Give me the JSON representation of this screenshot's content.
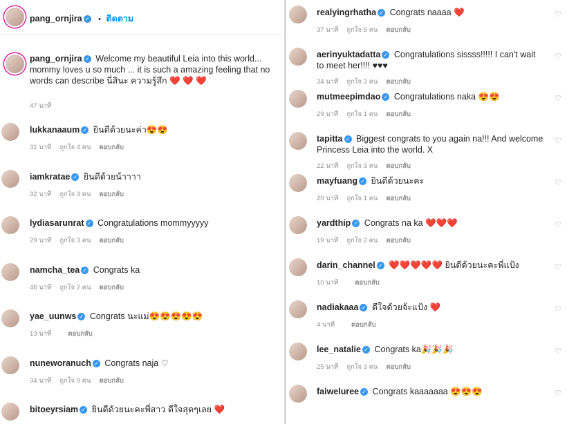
{
  "header": {
    "username": "pang_ornjira",
    "separator": "•",
    "follow_label": "ติดตาม"
  },
  "caption": {
    "username": "pang_ornjira",
    "text": "Welcome my beautiful Leia into this world... mommy loves u so much ... it is such a amazing feeling that no words can describe นี่สินะ ความรู้สึก ❤️ ❤️ ❤️",
    "time": "47 นาที"
  },
  "left_comments": [
    {
      "username": "lukkanaaum",
      "text": "ยินดีด้วยนะค่า😍😍",
      "time": "31 นาที",
      "likes": "ถูกใจ 4 คน",
      "reply": "ตอบกลับ"
    },
    {
      "username": "iamkratae",
      "text": "ยินดีด้วยน้าาาา",
      "time": "32 นาที",
      "likes": "ถูกใจ 3 คน",
      "reply": "ตอบกลับ"
    },
    {
      "username": "lydiasarunrat",
      "text": "Congratulations mommyyyyy",
      "time": "29 นาที",
      "likes": "ถูกใจ 3 คน",
      "reply": "ตอบกลับ"
    },
    {
      "username": "namcha_tea",
      "text": "Congrats ka",
      "time": "46 นาที",
      "likes": "ถูกใจ 2 คน",
      "reply": "ตอบกลับ"
    },
    {
      "username": "yae_uunws",
      "text": "Congrats นะแม่😍😍😍😍😍",
      "time": "13 นาที",
      "likes": "",
      "reply": "ตอบกลับ"
    },
    {
      "username": "nuneworanuch",
      "text": "Congrats naja ♡",
      "time": "34 นาที",
      "likes": "ถูกใจ 9 คน",
      "reply": "ตอบกลับ"
    },
    {
      "username": "bitoeyrsiam",
      "text": "ยินดีด้วยนะคะพี่สาว ดีใจสุดๆเลย ❤️",
      "time": "",
      "likes": "",
      "reply": ""
    }
  ],
  "right_comments": [
    {
      "username": "realyingrhatha",
      "text": "Congrats naaaa ❤️",
      "time": "37 นาที",
      "likes": "ถูกใจ 5 คน",
      "reply": "ตอบกลับ"
    },
    {
      "username": "aerinyuktadatta",
      "text": "Congratulations sissss!!!!! I can't wait to meet her!!!! ♥♥♥",
      "time": "34 นาที",
      "likes": "ถูกใจ 3 คน",
      "reply": "ตอบกลับ"
    },
    {
      "username": "mutmeepimdao",
      "text": "Congratulations naka 😍😍",
      "time": "29 นาที",
      "likes": "ถูกใจ 1 คน",
      "reply": "ตอบกลับ"
    },
    {
      "username": "tapitta",
      "text": "Biggest congrats to you again na!!! And welcome Princess Leia into the world. X",
      "time": "22 นาที",
      "likes": "ถูกใจ 3 คน",
      "reply": "ตอบกลับ"
    },
    {
      "username": "mayfuang",
      "text": "ยินดีด้วยนะคะ",
      "time": "20 นาที",
      "likes": "ถูกใจ 1 คน",
      "reply": "ตอบกลับ"
    },
    {
      "username": "yardthip",
      "text": "Congrats na ka ❤️❤️❤️",
      "time": "19 นาที",
      "likes": "ถูกใจ 2 คน",
      "reply": "ตอบกลับ"
    },
    {
      "username": "darin_channel",
      "text": "❤️❤️❤️❤️❤️ ยินดีด้วยนะคะพี่แป้ง",
      "time": "10 นาที",
      "likes": "",
      "reply": "ตอบกลับ"
    },
    {
      "username": "nadiakaaa",
      "text": "ดีใจด้วยจ้ะแป้ง ❤️",
      "time": "4 นาที",
      "likes": "",
      "reply": "ตอบกลับ"
    },
    {
      "username": "lee_natalie",
      "text": "Congrats ka🎉🎉🎉",
      "time": "25 นาที",
      "likes": "ถูกใจ 3 คน",
      "reply": "ตอบกลับ"
    },
    {
      "username": "faiweluree",
      "text": "Congrats kaaaaaaa 😍😍😍",
      "time": "",
      "likes": "",
      "reply": ""
    }
  ],
  "icons": {
    "like": "heart-outline-icon",
    "verified": "verified-badge-icon"
  },
  "colors": {
    "accent": "#0095f6",
    "verified": "#3897f0",
    "heart": "#e0245e"
  }
}
